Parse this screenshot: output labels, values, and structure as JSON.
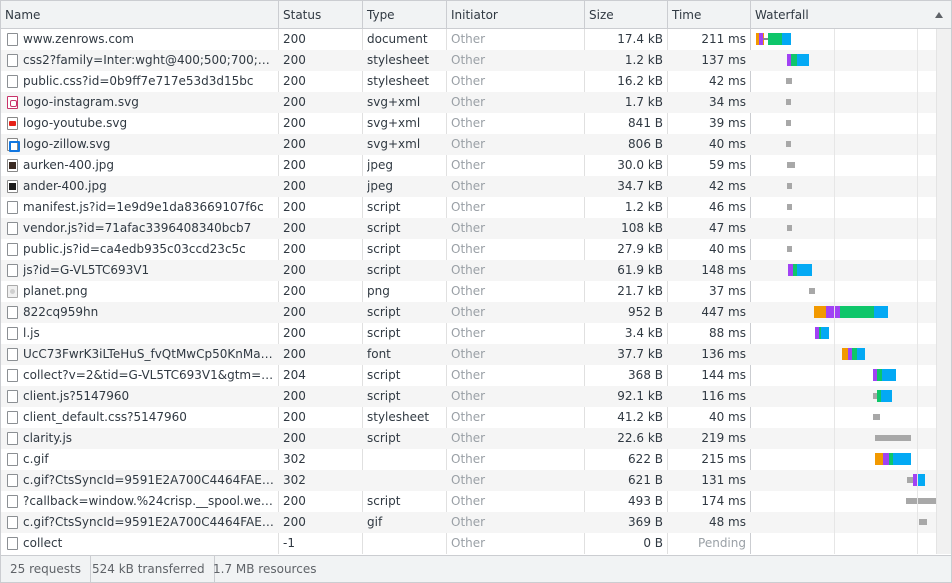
{
  "columns": {
    "name": "Name",
    "status": "Status",
    "type": "Type",
    "initiator": "Initiator",
    "size": "Size",
    "time": "Time",
    "waterfall": "Waterfall"
  },
  "requests": [
    {
      "name": "www.zenrows.com",
      "status": "200",
      "type": "document",
      "initiator": "Other",
      "size": "17.4 kB",
      "time": "211 ms",
      "icon": "document-icon"
    },
    {
      "name": "css2?family=Inter:wght@400;500;700;800;9…",
      "status": "200",
      "type": "stylesheet",
      "initiator": "Other",
      "size": "1.2 kB",
      "time": "137 ms",
      "icon": "document-icon"
    },
    {
      "name": "public.css?id=0b9ff7e717e53d3d15bc",
      "status": "200",
      "type": "stylesheet",
      "initiator": "Other",
      "size": "16.2 kB",
      "time": "42 ms",
      "icon": "document-icon"
    },
    {
      "name": "logo-instagram.svg",
      "status": "200",
      "type": "svg+xml",
      "initiator": "Other",
      "size": "1.7 kB",
      "time": "34 ms",
      "icon": "instagram-logo-icon"
    },
    {
      "name": "logo-youtube.svg",
      "status": "200",
      "type": "svg+xml",
      "initiator": "Other",
      "size": "841 B",
      "time": "39 ms",
      "icon": "youtube-logo-icon"
    },
    {
      "name": "logo-zillow.svg",
      "status": "200",
      "type": "svg+xml",
      "initiator": "Other",
      "size": "806 B",
      "time": "40 ms",
      "icon": "zillow-logo-icon"
    },
    {
      "name": "aurken-400.jpg",
      "status": "200",
      "type": "jpeg",
      "initiator": "Other",
      "size": "30.0 kB",
      "time": "59 ms",
      "icon": "photo-thumbnail-icon"
    },
    {
      "name": "ander-400.jpg",
      "status": "200",
      "type": "jpeg",
      "initiator": "Other",
      "size": "34.7 kB",
      "time": "42 ms",
      "icon": "photo-thumbnail-icon"
    },
    {
      "name": "manifest.js?id=1e9d9e1da83669107f6c",
      "status": "200",
      "type": "script",
      "initiator": "Other",
      "size": "1.2 kB",
      "time": "46 ms",
      "icon": "document-icon"
    },
    {
      "name": "vendor.js?id=71afac3396408340bcb7",
      "status": "200",
      "type": "script",
      "initiator": "Other",
      "size": "108 kB",
      "time": "47 ms",
      "icon": "document-icon"
    },
    {
      "name": "public.js?id=ca4edb935c03ccd23c5c",
      "status": "200",
      "type": "script",
      "initiator": "Other",
      "size": "27.9 kB",
      "time": "40 ms",
      "icon": "document-icon"
    },
    {
      "name": "js?id=G-VL5TC693V1",
      "status": "200",
      "type": "script",
      "initiator": "Other",
      "size": "61.9 kB",
      "time": "148 ms",
      "icon": "document-icon"
    },
    {
      "name": "planet.png",
      "status": "200",
      "type": "png",
      "initiator": "Other",
      "size": "21.7 kB",
      "time": "37 ms",
      "icon": "image-icon"
    },
    {
      "name": "822cq959hn",
      "status": "200",
      "type": "script",
      "initiator": "Other",
      "size": "952 B",
      "time": "447 ms",
      "icon": "document-icon"
    },
    {
      "name": "l.js",
      "status": "200",
      "type": "script",
      "initiator": "Other",
      "size": "3.4 kB",
      "time": "88 ms",
      "icon": "document-icon"
    },
    {
      "name": "UcC73FwrK3iLTeHuS_fvQtMwCp50KnMa1Z…",
      "status": "200",
      "type": "font",
      "initiator": "Other",
      "size": "37.7 kB",
      "time": "136 ms",
      "icon": "document-icon"
    },
    {
      "name": "collect?v=2&tid=G-VL5TC693V1&gtm=2oe9…",
      "status": "204",
      "type": "script",
      "initiator": "Other",
      "size": "368 B",
      "time": "144 ms",
      "icon": "document-icon"
    },
    {
      "name": "client.js?5147960",
      "status": "200",
      "type": "script",
      "initiator": "Other",
      "size": "92.1 kB",
      "time": "116 ms",
      "icon": "document-icon"
    },
    {
      "name": "client_default.css?5147960",
      "status": "200",
      "type": "stylesheet",
      "initiator": "Other",
      "size": "41.2 kB",
      "time": "40 ms",
      "icon": "document-icon"
    },
    {
      "name": "clarity.js",
      "status": "200",
      "type": "script",
      "initiator": "Other",
      "size": "22.6 kB",
      "time": "219 ms",
      "icon": "document-icon"
    },
    {
      "name": "c.gif",
      "status": "302",
      "type": "",
      "initiator": "Other",
      "size": "622 B",
      "time": "215 ms",
      "icon": "document-icon"
    },
    {
      "name": "c.gif?CtsSyncId=9591E2A700C4464FAE203…",
      "status": "302",
      "type": "",
      "initiator": "Other",
      "size": "621 B",
      "time": "131 ms",
      "icon": "document-icon"
    },
    {
      "name": "?callback=window.%24crisp.__spool.websit…",
      "status": "200",
      "type": "script",
      "initiator": "Other",
      "size": "493 B",
      "time": "174 ms",
      "icon": "document-icon"
    },
    {
      "name": "c.gif?CtsSyncId=9591E2A700C4464FAE203…",
      "status": "200",
      "type": "gif",
      "initiator": "Other",
      "size": "369 B",
      "time": "48 ms",
      "icon": "document-icon"
    },
    {
      "name": "collect",
      "status": "-1",
      "type": "",
      "initiator": "Other",
      "size": "0 B",
      "time": "Pending",
      "icon": "document-icon"
    }
  ],
  "waterfall_phase_colors": {
    "queueing": "#ffffff",
    "stalled": "#a8a8a8",
    "dns": "#f29900",
    "connect": "#a142f4",
    "request_sent": "#1e8e3e",
    "waiting": "#0ec66a",
    "download": "#03a9f4"
  },
  "summary": {
    "requests": "25 requests",
    "transferred": "524 kB transferred",
    "resources": "1.7 MB resources"
  }
}
